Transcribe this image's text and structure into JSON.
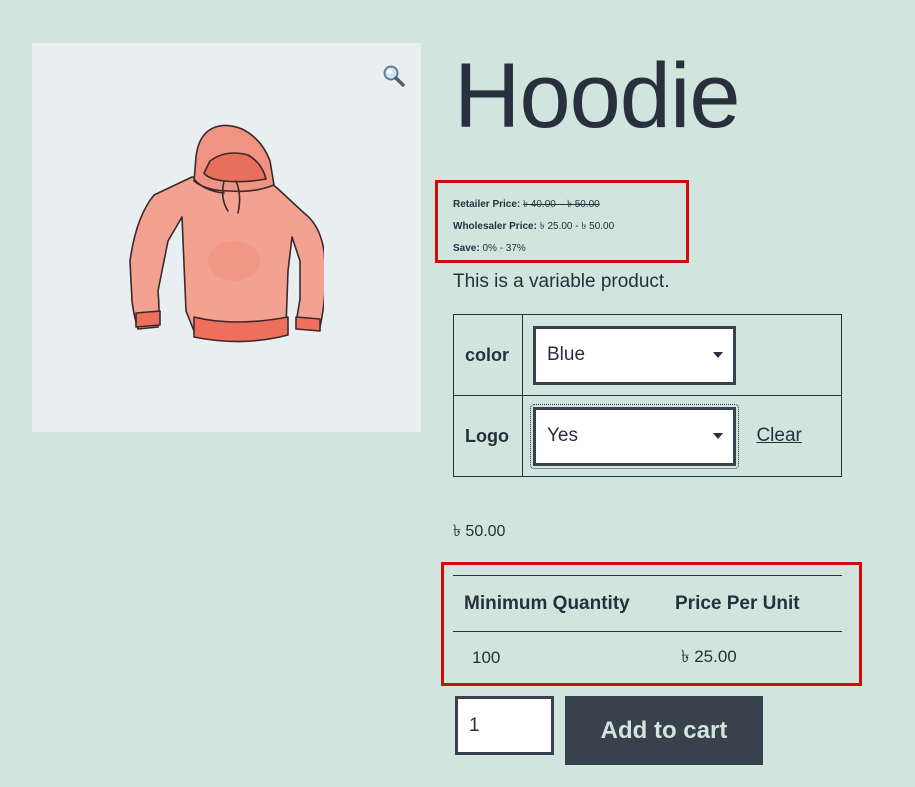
{
  "product": {
    "title": "Hoodie",
    "description": "This is a variable product.",
    "image_icon": "hoodie-image",
    "zoom_icon": "magnifier-icon"
  },
  "pricing": {
    "retailer_label": "Retailer Price:",
    "retailer_value": "৳ 40.00 – ৳ 50.00",
    "wholesaler_label": "Wholesaler Price:",
    "wholesaler_value": "৳ 25.00 - ৳ 50.00",
    "save_label": "Save:",
    "save_value": "0% - 37%"
  },
  "variations": [
    {
      "label": "color",
      "selected": "Blue"
    },
    {
      "label": "Logo",
      "selected": "Yes"
    }
  ],
  "clear_label": "Clear",
  "variation_price": "৳ 50.00",
  "tier_table": {
    "headers": [
      "Minimum Quantity",
      "Price Per Unit"
    ],
    "rows": [
      [
        "100",
        "৳ 25.00"
      ]
    ]
  },
  "cart": {
    "quantity": "1",
    "button_label": "Add to cart"
  },
  "colors": {
    "background": "#d1e4dd",
    "text": "#28303d",
    "highlight_border": "#d10a0a",
    "button": "#39414d"
  }
}
